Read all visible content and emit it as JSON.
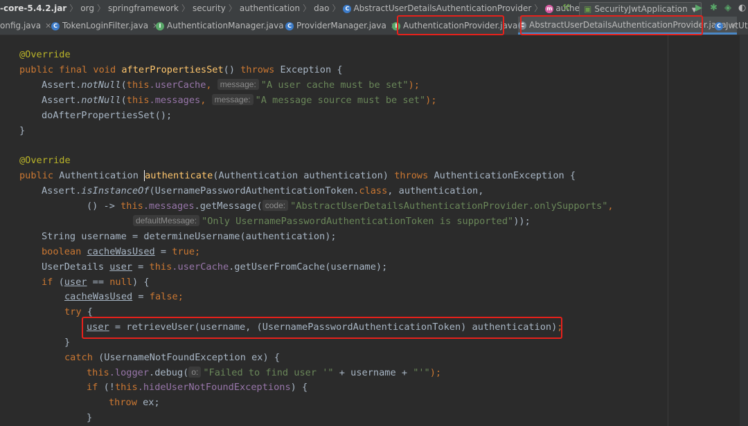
{
  "breadcrumbs": {
    "jar": "-core-5.4.2.jar",
    "items": [
      "org",
      "springframework",
      "security",
      "authentication",
      "dao"
    ],
    "class_name": "AbstractUserDetailsAuthenticationProvider",
    "method_name": "authenticate"
  },
  "run_config": {
    "label": "SecurityJwtApplication"
  },
  "tabs": [
    {
      "label": "onfig.java",
      "icon": "class-icon"
    },
    {
      "label": "TokenLoginFilter.java",
      "icon": "class-icon"
    },
    {
      "label": "AuthenticationManager.java",
      "icon": "interface-icon"
    },
    {
      "label": "ProviderManager.java",
      "icon": "class-icon"
    },
    {
      "label": "AuthenticationProvider.java",
      "icon": "interface-icon"
    },
    {
      "label": "AbstractUserDetailsAuthenticationProvider.java",
      "icon": "abstract-class-icon"
    },
    {
      "label": "JwtUti",
      "icon": "class-icon"
    }
  ],
  "highlight_color": "#e8211b",
  "code": {
    "l01_annotation": "@Override",
    "l02_modifiers": "public final void ",
    "l02_method": "afterPropertiesSet",
    "l02_params": "() ",
    "l02_throws": "throws ",
    "l02_exception": "Exception {",
    "l03_pre": "Assert.",
    "l03_call": "notNull",
    "l03_open": "(",
    "l03_this": "this",
    "l03_field": ".userCache",
    "l03_comma": ", ",
    "l03_hint": "message:",
    "l03_string": "\"A user cache must be set\"",
    "l03_end": ");",
    "l04_pre": "Assert.",
    "l04_call": "notNull",
    "l04_open": "(",
    "l04_this": "this",
    "l04_field": ".messages",
    "l04_comma": ", ",
    "l04_hint": "message:",
    "l04_string": "\"A message source must be set\"",
    "l04_end": ");",
    "l05": "doAfterPropertiesSet();",
    "l06": "}",
    "l08_annotation": "@Override",
    "l09_kw": "public ",
    "l09_type": "Authentication ",
    "l09_method": "authenticate",
    "l09_params": "(Authentication authentication) ",
    "l09_throws": "throws ",
    "l09_exception": "AuthenticationException {",
    "l10_pre": "Assert.",
    "l10_call": "isInstanceOf",
    "l10_args": "(UsernamePasswordAuthenticationToken.",
    "l10_class": "class",
    "l10_end": ", authentication,",
    "l11_lambda": "() -> ",
    "l11_this": "this",
    "l11_field": ".messages",
    "l11_call": ".getMessage(",
    "l11_hint": "code:",
    "l11_string": "\"AbstractUserDetailsAuthenticationProvider.onlySupports\"",
    "l11_end": ",",
    "l12_hint": "defaultMessage:",
    "l12_string": "\"Only UsernamePasswordAuthenticationToken is supported\"",
    "l12_end": "));",
    "l13": "String username = determineUsername(authentication);",
    "l14_type": "boolean ",
    "l14_var": "cacheWasUsed",
    "l14_eq": " = ",
    "l14_val": "true",
    "l14_end": ";",
    "l15_type": "UserDetails ",
    "l15_var": "user",
    "l15_eq": " = ",
    "l15_this": "this",
    "l15_field": ".userCache",
    "l15_call": ".getUserFromCache(username);",
    "l16_kw": "if ",
    "l16_open": "(",
    "l16_var": "user",
    "l16_op": " == ",
    "l16_null": "null",
    "l16_end": ") {",
    "l17_var": "cacheWasUsed",
    "l17_eq": " = ",
    "l17_val": "false",
    "l17_end": ";",
    "l18_kw": "try",
    "l18_end": " {",
    "l19_var": "user",
    "l19_rest": " = retrieveUser(username, (UsernamePasswordAuthenticationToken) authentication)",
    "l19_end": ";",
    "l20": "}",
    "l21_kw": "catch ",
    "l21_rest": "(UsernameNotFoundException ex) {",
    "l22_this": "this",
    "l22_field": ".logger",
    "l22_call": ".debug(",
    "l22_hint": "o:",
    "l22_string": "\"Failed to find user '\"",
    "l22_mid": " + username + ",
    "l22_string2": "\"'\"",
    "l22_end": ");",
    "l23_kw": "if ",
    "l23_open": "(!",
    "l23_this": "this",
    "l23_field": ".hideUserNotFoundExceptions",
    "l23_end": ") {",
    "l24_kw": "throw ",
    "l24_rest": "ex;",
    "l25": "}"
  }
}
